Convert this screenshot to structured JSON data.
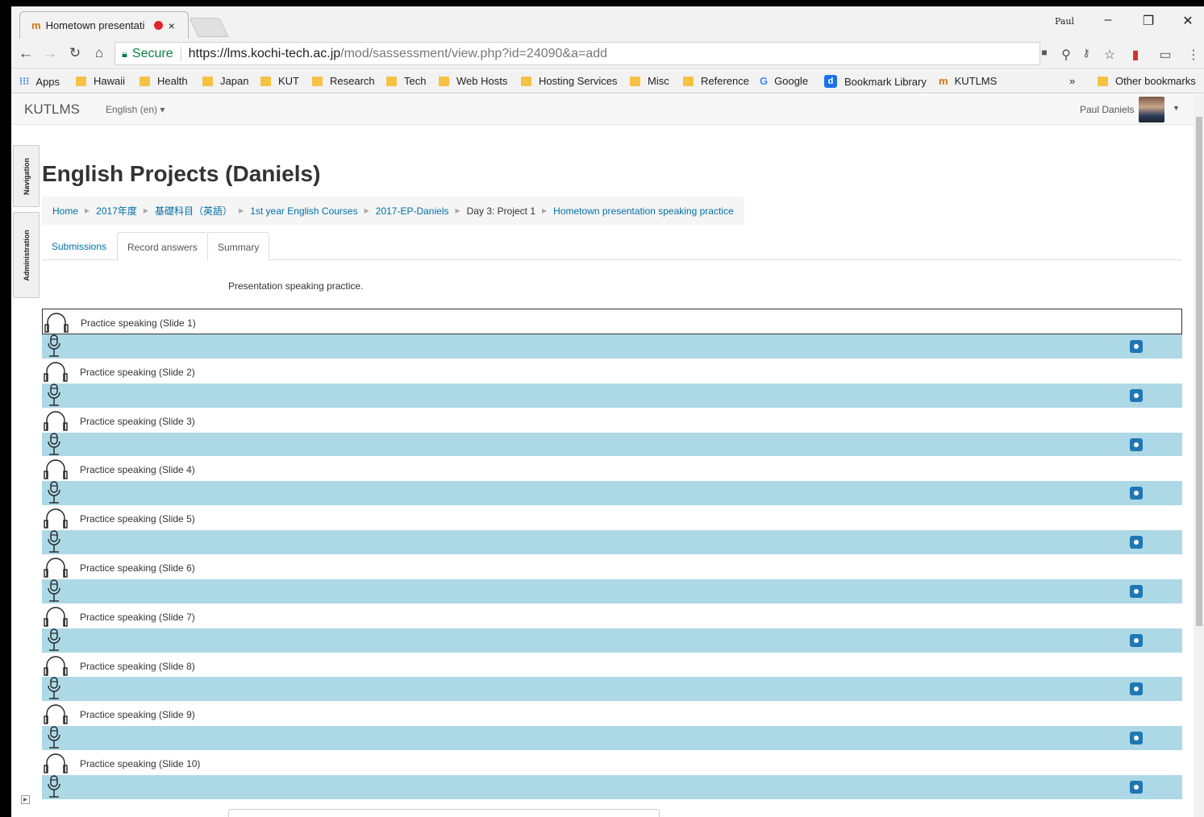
{
  "browser": {
    "tab_title": "Hometown presentati",
    "tab_favicon": "m",
    "profile_name": "Paul",
    "url_secure_label": "Secure",
    "url_host": "https://lms.kochi-tech.ac.jp",
    "url_path": "/mod/sassessment/view.php?id=24090&a=add",
    "bookmarks": [
      {
        "label": "Apps"
      },
      {
        "label": "Hawaii"
      },
      {
        "label": "Health"
      },
      {
        "label": "Japan"
      },
      {
        "label": "KUT"
      },
      {
        "label": "Research"
      },
      {
        "label": "Tech"
      },
      {
        "label": "Web Hosts"
      },
      {
        "label": "Hosting Services"
      },
      {
        "label": "Misc"
      },
      {
        "label": "Reference"
      },
      {
        "label": "Google"
      },
      {
        "label": "Bookmark Library"
      },
      {
        "label": "KUTLMS"
      }
    ],
    "bookmarks_overflow": "»",
    "other_bookmarks": "Other bookmarks"
  },
  "navbar": {
    "brand": "KUTLMS",
    "language": "English (en) ▾",
    "user_name": "Paul Daniels"
  },
  "side_blocks": {
    "navigation": "Navigation",
    "administration": "Administration"
  },
  "page": {
    "title": "English Projects (Daniels)",
    "breadcrumb": [
      {
        "label": "Home",
        "link": true
      },
      {
        "label": "2017年度",
        "link": true
      },
      {
        "label": "基礎科目（英語）",
        "link": true
      },
      {
        "label": "1st year English Courses",
        "link": true
      },
      {
        "label": "2017-EP-Daniels",
        "link": true
      },
      {
        "label": "Day 3: Project 1",
        "link": false
      },
      {
        "label": "Hometown presentation speaking practice",
        "link": true
      }
    ],
    "tabs": [
      {
        "label": "Submissions",
        "active": false
      },
      {
        "label": "Record answers",
        "active": true
      },
      {
        "label": "Summary",
        "active": false
      }
    ],
    "intro": "Presentation speaking practice.",
    "questions": [
      {
        "label": "Practice speaking (Slide 1)"
      },
      {
        "label": "Practice speaking (Slide 2)"
      },
      {
        "label": "Practice speaking (Slide 3)"
      },
      {
        "label": "Practice speaking (Slide 4)"
      },
      {
        "label": "Practice speaking (Slide 5)"
      },
      {
        "label": "Practice speaking (Slide 6)"
      },
      {
        "label": "Practice speaking (Slide 7)"
      },
      {
        "label": "Practice speaking (Slide 8)"
      },
      {
        "label": "Practice speaking (Slide 9)"
      },
      {
        "label": "Practice speaking (Slide 10)"
      }
    ]
  },
  "colors": {
    "answer_row": "#add8e6",
    "link": "#0070a8",
    "record_button": "#1f77b4"
  }
}
